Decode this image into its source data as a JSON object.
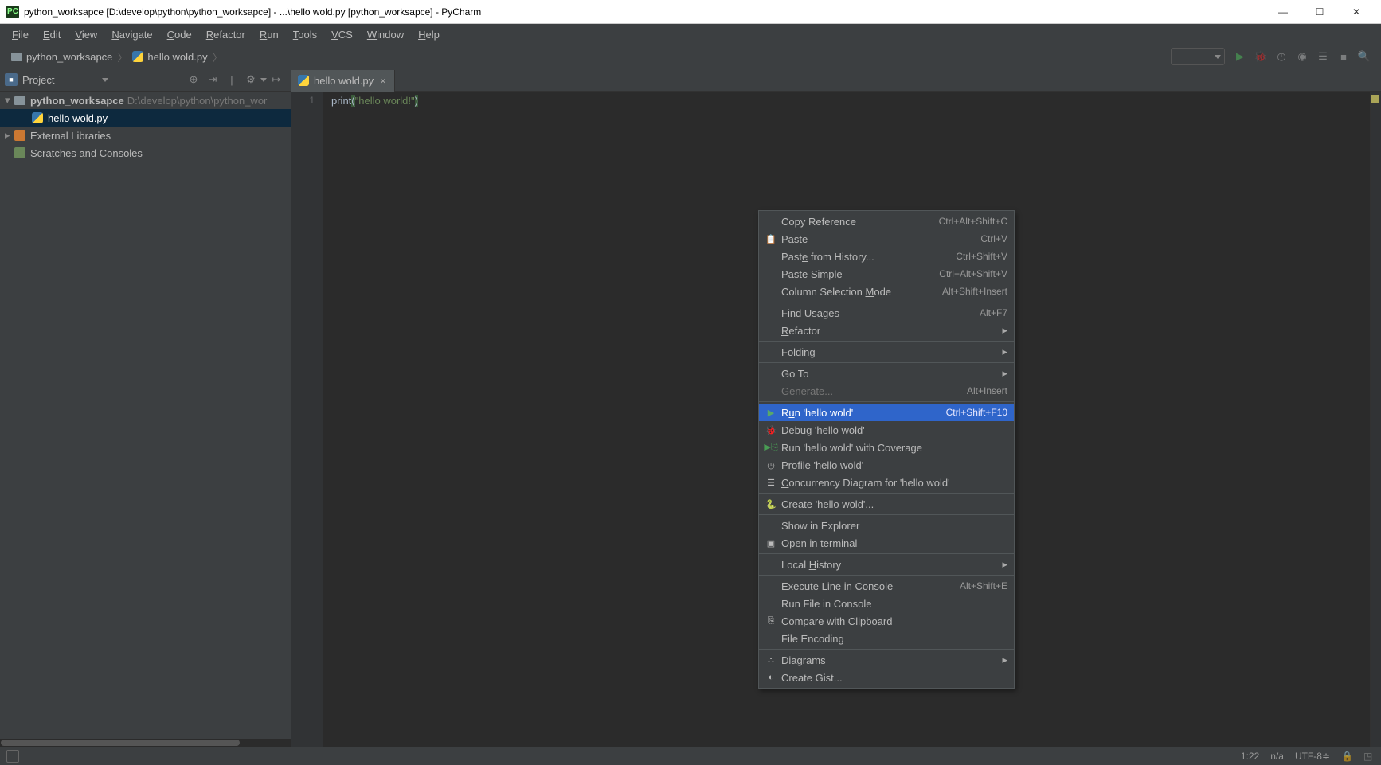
{
  "window": {
    "title": "python_worksapce [D:\\develop\\python\\python_worksapce] - ...\\hello wold.py [python_worksapce] - PyCharm",
    "minimize": "—",
    "maximize": "☐",
    "close": "✕"
  },
  "menubar": [
    "File",
    "Edit",
    "View",
    "Navigate",
    "Code",
    "Refactor",
    "Run",
    "Tools",
    "VCS",
    "Window",
    "Help"
  ],
  "breadcrumb": {
    "project": "python_worksapce",
    "file": "hello wold.py"
  },
  "toolbar_icons": [
    "run",
    "debug",
    "coverage",
    "profile",
    "layout",
    "stop",
    "search"
  ],
  "sidebar": {
    "title": "Project",
    "tree": [
      {
        "label": "python_worksapce",
        "hint": "D:\\develop\\python\\python_wor",
        "type": "folder",
        "expanded": true,
        "indent": 0
      },
      {
        "label": "hello wold.py",
        "hint": "",
        "type": "python",
        "indent": 1,
        "selected": true
      },
      {
        "label": "External Libraries",
        "hint": "",
        "type": "lib",
        "indent": 0,
        "expandable": true
      },
      {
        "label": "Scratches and Consoles",
        "hint": "",
        "type": "scratch",
        "indent": 0
      }
    ]
  },
  "tab": {
    "label": "hello wold.py"
  },
  "editor": {
    "line_number": "1",
    "code_print": "print",
    "code_paren_open": "(",
    "code_string": "\"hello world!\"",
    "code_paren_close": ")"
  },
  "context_menu": [
    {
      "label": "Copy Reference",
      "shortcut": "Ctrl+Alt+Shift+C",
      "icon": ""
    },
    {
      "label": "Paste",
      "shortcut": "Ctrl+V",
      "icon": "📋",
      "u": 0
    },
    {
      "label": "Paste from History...",
      "shortcut": "Ctrl+Shift+V",
      "icon": "",
      "u": 4
    },
    {
      "label": "Paste Simple",
      "shortcut": "Ctrl+Alt+Shift+V",
      "icon": ""
    },
    {
      "label": "Column Selection Mode",
      "shortcut": "Alt+Shift+Insert",
      "icon": "",
      "u": 17
    },
    {
      "sep": true
    },
    {
      "label": "Find Usages",
      "shortcut": "Alt+F7",
      "icon": "",
      "u": 5
    },
    {
      "label": "Refactor",
      "submenu": true,
      "icon": "",
      "u": 0
    },
    {
      "sep": true
    },
    {
      "label": "Folding",
      "submenu": true,
      "icon": ""
    },
    {
      "sep": true
    },
    {
      "label": "Go To",
      "submenu": true,
      "icon": ""
    },
    {
      "label": "Generate...",
      "shortcut": "Alt+Insert",
      "icon": "",
      "disabled": true
    },
    {
      "sep": true
    },
    {
      "label": "Run 'hello wold'",
      "shortcut": "Ctrl+Shift+F10",
      "icon": "▶",
      "highlighted": true,
      "icon_color": "#59a869",
      "u": 1
    },
    {
      "label": "Debug 'hello wold'",
      "icon": "🐞",
      "icon_color": "#499c54",
      "u": 0
    },
    {
      "label": "Run 'hello wold' with Coverage",
      "icon": "▶⎘",
      "icon_color": "#499c54"
    },
    {
      "label": "Profile 'hello wold'",
      "icon": "◷"
    },
    {
      "label": "Concurrency Diagram for 'hello wold'",
      "icon": "☰",
      "u": 0
    },
    {
      "sep": true
    },
    {
      "label": "Create 'hello wold'...",
      "icon": "🐍"
    },
    {
      "sep": true
    },
    {
      "label": "Show in Explorer",
      "icon": ""
    },
    {
      "label": "Open in terminal",
      "icon": "▣"
    },
    {
      "sep": true
    },
    {
      "label": "Local History",
      "submenu": true,
      "icon": "",
      "u": 6
    },
    {
      "sep": true
    },
    {
      "label": "Execute Line in Console",
      "shortcut": "Alt+Shift+E",
      "icon": ""
    },
    {
      "label": "Run File in Console",
      "icon": ""
    },
    {
      "label": "Compare with Clipboard",
      "icon": "⎘",
      "u": 18
    },
    {
      "label": "File Encoding",
      "icon": ""
    },
    {
      "sep": true
    },
    {
      "label": "Diagrams",
      "submenu": true,
      "icon": "⛬",
      "u": 0
    },
    {
      "label": "Create Gist...",
      "icon": "◐"
    }
  ],
  "statusbar": {
    "position": "1:22",
    "insert": "n/a",
    "encoding": "UTF-8",
    "encoding_arrow": "≑"
  }
}
